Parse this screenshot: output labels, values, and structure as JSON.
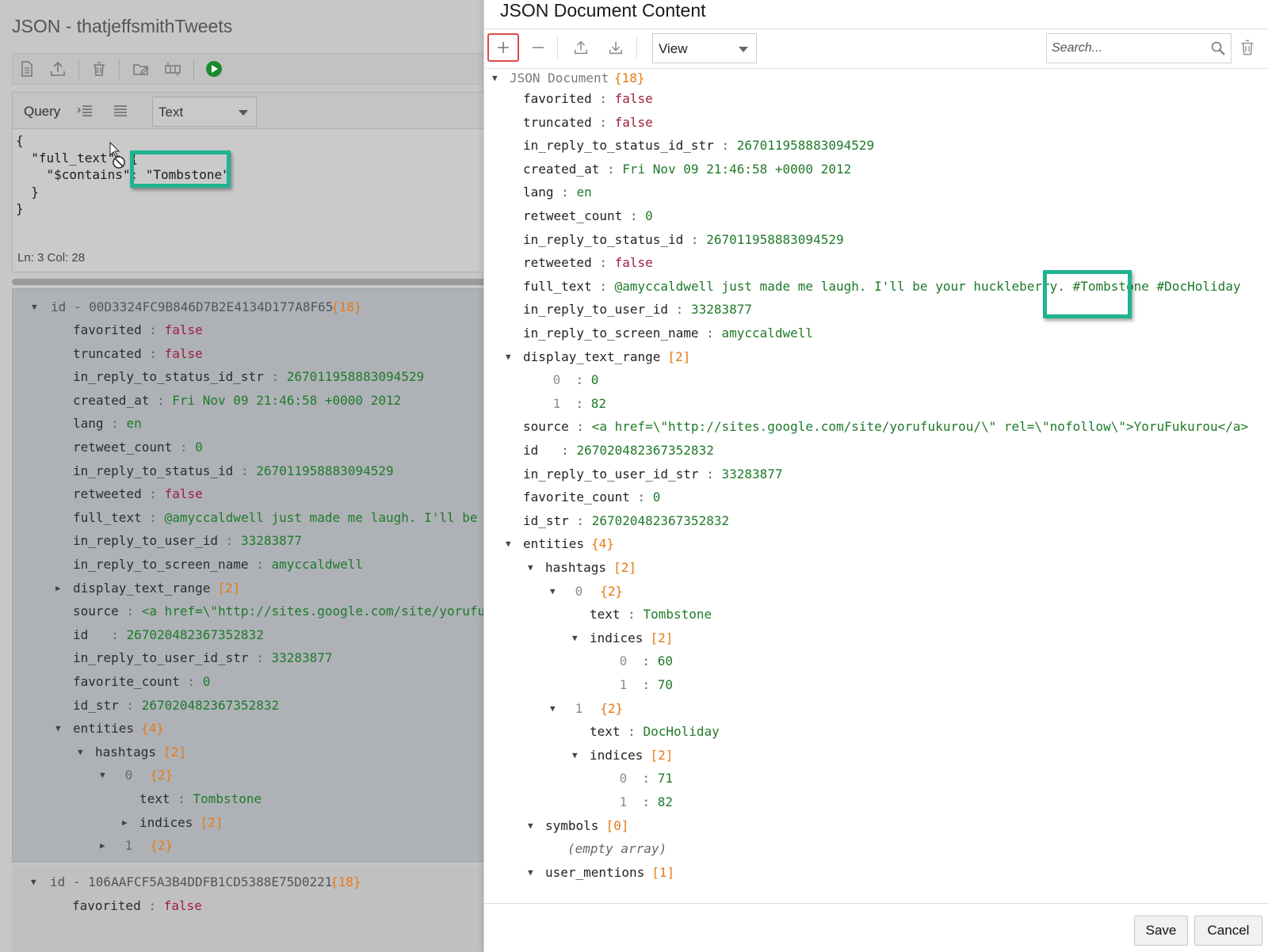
{
  "left": {
    "title": "JSON - thatjeffsmithTweets",
    "query_label": "Query",
    "mode_value": "Text",
    "code": "{\n  \"full_text\": {\n    \"$contains\": \"Tombstone\"\n  }\n}",
    "status": "Ln: 3    Col: 28",
    "doc1_id": "id - 00D3324FC9B846D7B2E4134D177A8F65",
    "doc1_count": "{18}",
    "doc2_id": "id - 106AAFCF5A3B4DDFB1CD5388E75D0221",
    "doc2_count": "{18}",
    "rows": [
      {
        "k": "favorited",
        "v": "false",
        "t": "bool"
      },
      {
        "k": "truncated",
        "v": "false",
        "t": "bool"
      },
      {
        "k": "in_reply_to_status_id_str",
        "v": "267011958883094529",
        "t": "num"
      },
      {
        "k": "created_at",
        "v": "Fri Nov 09 21:46:58 +0000 2012",
        "t": "str"
      },
      {
        "k": "lang",
        "v": "en",
        "t": "str"
      },
      {
        "k": "retweet_count",
        "v": "0",
        "t": "num"
      },
      {
        "k": "in_reply_to_status_id",
        "v": "267011958883094529",
        "t": "num"
      },
      {
        "k": "retweeted",
        "v": "false",
        "t": "bool"
      },
      {
        "k": "full_text",
        "v": "@amyccaldwell just made me laugh. I'll be yo",
        "t": "str"
      },
      {
        "k": "in_reply_to_user_id",
        "v": "33283877",
        "t": "num"
      },
      {
        "k": "in_reply_to_screen_name",
        "v": "amyccaldwell",
        "t": "str"
      },
      {
        "k": "display_text_range",
        "c": "[2]",
        "toggle": "closed"
      },
      {
        "k": "source",
        "v": "<a href=\\\"http://sites.google.com/site/yorufuku",
        "t": "str"
      },
      {
        "k": "id  ",
        "v": "267020482367352832",
        "t": "num"
      },
      {
        "k": "in_reply_to_user_id_str",
        "v": "33283877",
        "t": "num"
      },
      {
        "k": "favorite_count",
        "v": "0",
        "t": "num"
      },
      {
        "k": "id_str",
        "v": "267020482367352832",
        "t": "num"
      },
      {
        "k": "entities",
        "c": "{4}",
        "toggle": "open"
      },
      {
        "k": "hashtags",
        "c": "[2]",
        "toggle": "open",
        "lvl": 1
      },
      {
        "k": "0",
        "c": "{2}",
        "toggle": "open",
        "lvl": 2,
        "index": true
      },
      {
        "k": "text",
        "v": "Tombstone",
        "t": "str",
        "lvl": 3
      },
      {
        "k": "indices",
        "c": "[2]",
        "toggle": "closed",
        "lvl": 3
      },
      {
        "k": "1",
        "c": "{2}",
        "toggle": "closed",
        "lvl": 2,
        "index": true
      }
    ],
    "doc2_rows": [
      {
        "k": "favorited",
        "v": "false",
        "t": "bool"
      }
    ]
  },
  "dialog": {
    "title": "JSON Document Content",
    "view_value": "View",
    "search_placeholder": "Search...",
    "root_label": "JSON Document",
    "root_count": "{18}",
    "rows": [
      {
        "k": "favorited",
        "v": "false",
        "t": "bool"
      },
      {
        "k": "truncated",
        "v": "false",
        "t": "bool"
      },
      {
        "k": "in_reply_to_status_id_str",
        "v": "267011958883094529",
        "t": "num"
      },
      {
        "k": "created_at",
        "v": "Fri Nov 09 21:46:58 +0000 2012",
        "t": "str"
      },
      {
        "k": "lang",
        "v": "en",
        "t": "str"
      },
      {
        "k": "retweet_count",
        "v": "0",
        "t": "num"
      },
      {
        "k": "in_reply_to_status_id",
        "v": "267011958883094529",
        "t": "num"
      },
      {
        "k": "retweeted",
        "v": "false",
        "t": "bool"
      },
      {
        "k": "full_text",
        "v": "@amyccaldwell just made me laugh. I'll be your huckleberry. #Tombstone #DocHoliday",
        "t": "str"
      },
      {
        "k": "in_reply_to_user_id",
        "v": "33283877",
        "t": "num"
      },
      {
        "k": "in_reply_to_screen_name",
        "v": "amyccaldwell",
        "t": "str"
      },
      {
        "k": "display_text_range",
        "c": "[2]",
        "toggle": "open"
      },
      {
        "k": "0",
        "v": "0",
        "t": "num",
        "lvl": 1,
        "index": true
      },
      {
        "k": "1",
        "v": "82",
        "t": "num",
        "lvl": 1,
        "index": true
      },
      {
        "k": "source",
        "v": "<a href=\\\"http://sites.google.com/site/yorufukurou/\\\" rel=\\\"nofollow\\\">YoruFukurou</a>",
        "t": "str"
      },
      {
        "k": "id  ",
        "v": "267020482367352832",
        "t": "num"
      },
      {
        "k": "in_reply_to_user_id_str",
        "v": "33283877",
        "t": "num"
      },
      {
        "k": "favorite_count",
        "v": "0",
        "t": "num"
      },
      {
        "k": "id_str",
        "v": "267020482367352832",
        "t": "num"
      },
      {
        "k": "entities",
        "c": "{4}",
        "toggle": "open"
      },
      {
        "k": "hashtags",
        "c": "[2]",
        "toggle": "open",
        "lvl": 1
      },
      {
        "k": "0",
        "c": "{2}",
        "toggle": "open",
        "lvl": 2,
        "index": true
      },
      {
        "k": "text",
        "v": "Tombstone",
        "t": "str",
        "lvl": 3
      },
      {
        "k": "indices",
        "c": "[2]",
        "toggle": "open",
        "lvl": 3
      },
      {
        "k": "0",
        "v": "60",
        "t": "num",
        "lvl": 4,
        "index": true
      },
      {
        "k": "1",
        "v": "70",
        "t": "num",
        "lvl": 4,
        "index": true
      },
      {
        "k": "1",
        "c": "{2}",
        "toggle": "open",
        "lvl": 2,
        "index": true
      },
      {
        "k": "text",
        "v": "DocHoliday",
        "t": "str",
        "lvl": 3
      },
      {
        "k": "indices",
        "c": "[2]",
        "toggle": "open",
        "lvl": 3
      },
      {
        "k": "0",
        "v": "71",
        "t": "num",
        "lvl": 4,
        "index": true
      },
      {
        "k": "1",
        "v": "82",
        "t": "num",
        "lvl": 4,
        "index": true
      },
      {
        "k": "symbols",
        "c": "[0]",
        "toggle": "open",
        "lvl": 1
      },
      {
        "empty": "(empty array)",
        "lvl": 2
      },
      {
        "k": "user_mentions",
        "c": "[1]",
        "toggle": "open",
        "lvl": 1
      }
    ],
    "save_label": "Save",
    "cancel_label": "Cancel"
  },
  "colors": {
    "highlight": "#20b391",
    "string_value": "#1f7a28",
    "boolean_value": "#a01d3e",
    "count": "#e67a12",
    "add_button_border": "#d94b4b"
  },
  "icons": [
    "document-icon",
    "upload-icon",
    "trash-icon",
    "folder-edit-icon",
    "indexes-icon",
    "run-icon",
    "indent-icon",
    "format-icon",
    "plus-icon",
    "minus-icon",
    "export-icon",
    "download-icon",
    "search-icon",
    "trash-icon"
  ]
}
